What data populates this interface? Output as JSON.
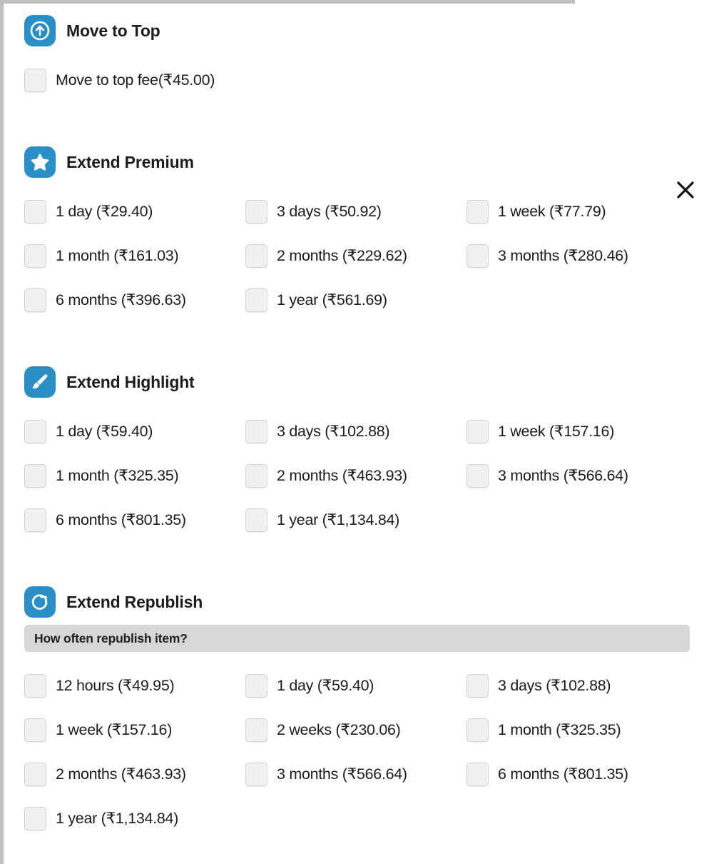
{
  "frame": {
    "close_label": "×"
  },
  "sections": [
    {
      "id": "move-to-top",
      "title": "Move to Top",
      "icon": "arrow-up-circle-icon",
      "options": [
        {
          "label": "Move to top fee(₹45.00)"
        }
      ]
    },
    {
      "id": "extend-premium",
      "title": "Extend Premium",
      "icon": "star-icon",
      "options": [
        {
          "label": "1 day (₹29.40)"
        },
        {
          "label": "3 days (₹50.92)"
        },
        {
          "label": "1 week (₹77.79)"
        },
        {
          "label": "1 month (₹161.03)"
        },
        {
          "label": "2 months (₹229.62)"
        },
        {
          "label": "3 months (₹280.46)"
        },
        {
          "label": "6 months (₹396.63)"
        },
        {
          "label": "1 year (₹561.69)"
        }
      ]
    },
    {
      "id": "extend-highlight",
      "title": "Extend Highlight",
      "icon": "paintbrush-icon",
      "options": [
        {
          "label": "1 day (₹59.40)"
        },
        {
          "label": "3 days (₹102.88)"
        },
        {
          "label": "1 week (₹157.16)"
        },
        {
          "label": "1 month (₹325.35)"
        },
        {
          "label": "2 months (₹463.93)"
        },
        {
          "label": "3 months (₹566.64)"
        },
        {
          "label": "6 months (₹801.35)"
        },
        {
          "label": "1 year (₹1,134.84)"
        }
      ]
    },
    {
      "id": "extend-republish",
      "title": "Extend Republish",
      "icon": "refresh-icon",
      "subhead": "How often republish item?",
      "options": [
        {
          "label": "12 hours (₹49.95)"
        },
        {
          "label": "1 day (₹59.40)"
        },
        {
          "label": "3 days (₹102.88)"
        },
        {
          "label": "1 week (₹157.16)"
        },
        {
          "label": "2 weeks (₹230.06)"
        },
        {
          "label": "1 month (₹325.35)"
        },
        {
          "label": "2 months (₹463.93)"
        },
        {
          "label": "3 months (₹566.64)"
        },
        {
          "label": "6 months (₹801.35)"
        },
        {
          "label": "1 year (₹1,134.84)"
        }
      ]
    }
  ],
  "colors": {
    "accent": "#2a8fc4",
    "checkbox_fill": "#f0f0f0",
    "subhead_bar": "#d7d7d7",
    "frame_border": "#c0c0c0"
  }
}
